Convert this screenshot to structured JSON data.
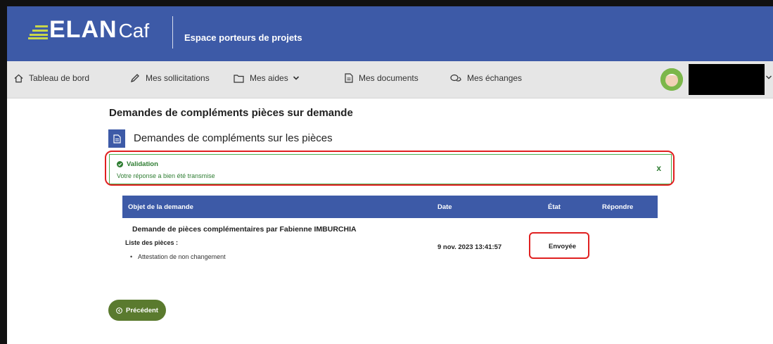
{
  "header": {
    "logo_main": "ELAN",
    "logo_sub": "Caf",
    "subtitle": "Espace porteurs de projets"
  },
  "nav": {
    "items": [
      {
        "label": "Tableau de bord",
        "icon": "home-icon"
      },
      {
        "label": "Mes sollicitations",
        "icon": "pen-icon"
      },
      {
        "label": "Mes aides",
        "icon": "folder-icon"
      },
      {
        "label": "Mes documents",
        "icon": "document-icon"
      },
      {
        "label": "Mes échanges",
        "icon": "chat-icon"
      }
    ]
  },
  "page": {
    "title": "Demandes de compléments pièces sur demande",
    "section_title": "Demandes de compléments sur les pièces"
  },
  "alert": {
    "title": "Validation",
    "message": "Votre réponse a bien été transmise",
    "close": "x"
  },
  "table": {
    "headers": {
      "object": "Objet de la demande",
      "date": "Date",
      "state": "État",
      "reply": "Répondre"
    },
    "row": {
      "title": "Demande de pièces complémentaires par Fabienne IMBURCHIA",
      "list_label": "Liste des pièces :",
      "piece": "Attestation de non changement",
      "date": "9 nov. 2023 13:41:57",
      "state": "Envoyée"
    }
  },
  "buttons": {
    "previous": "Précédent"
  },
  "colors": {
    "primary": "#3d5aa7",
    "nav_bg": "#e6e6e6",
    "success": "#2e7d32",
    "highlight": "#e02020",
    "button": "#5a7a2e"
  }
}
